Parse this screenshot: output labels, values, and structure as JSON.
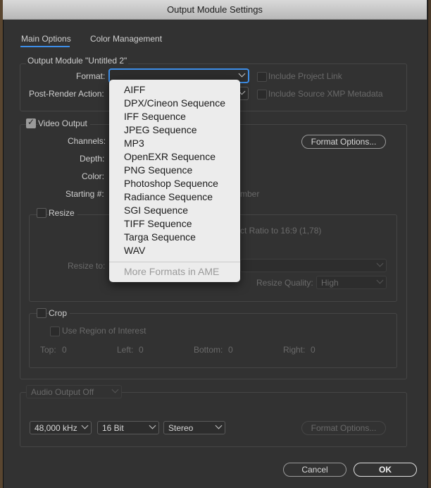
{
  "window": {
    "title": "Output Module Settings"
  },
  "tabs": [
    {
      "label": "Main Options",
      "active": true
    },
    {
      "label": "Color Management",
      "active": false
    }
  ],
  "output_module": {
    "heading": "Output Module \"Untitled 2\"",
    "format_label": "Format:",
    "format_value": "",
    "post_render_label": "Post-Render Action:",
    "include_project_link": "Include Project Link",
    "include_xmp": "Include Source XMP Metadata"
  },
  "video_output": {
    "label": "Video Output",
    "checked": true,
    "channels_label": "Channels:",
    "depth_label": "Depth:",
    "color_label": "Color:",
    "starting_label": "Starting #:",
    "starting_tail": "mber",
    "format_options": "Format Options...",
    "resize_label": "Resize",
    "aspect_text": "ct Ratio to 16:9 (1,78)",
    "resize_to_label": "Resize to:",
    "resize_quality_label": "Resize Quality:",
    "resize_quality_value": "High",
    "crop_label": "Crop",
    "use_roi": "Use Region of Interest",
    "top_label": "Top:",
    "top_value": "0",
    "left_label": "Left:",
    "left_value": "0",
    "bottom_label": "Bottom:",
    "bottom_value": "0",
    "right_label": "Right:",
    "right_value": "0"
  },
  "audio": {
    "output_select": "Audio Output Off",
    "rate": "48,000 kHz",
    "bits": "16 Bit",
    "channels": "Stereo",
    "format_options": "Format Options..."
  },
  "format_menu": {
    "items": [
      "AIFF",
      "DPX/Cineon Sequence",
      "IFF Sequence",
      "JPEG Sequence",
      "MP3",
      "OpenEXR Sequence",
      "PNG Sequence",
      "Photoshop Sequence",
      "Radiance Sequence",
      "SGI Sequence",
      "TIFF Sequence",
      "Targa Sequence",
      "WAV"
    ],
    "more": "More Formats in AME"
  },
  "buttons": {
    "cancel": "Cancel",
    "ok": "OK"
  },
  "colors": {
    "accent": "#3d8ee8",
    "menu_bg": "#ececec",
    "window_bg": "#323232"
  }
}
